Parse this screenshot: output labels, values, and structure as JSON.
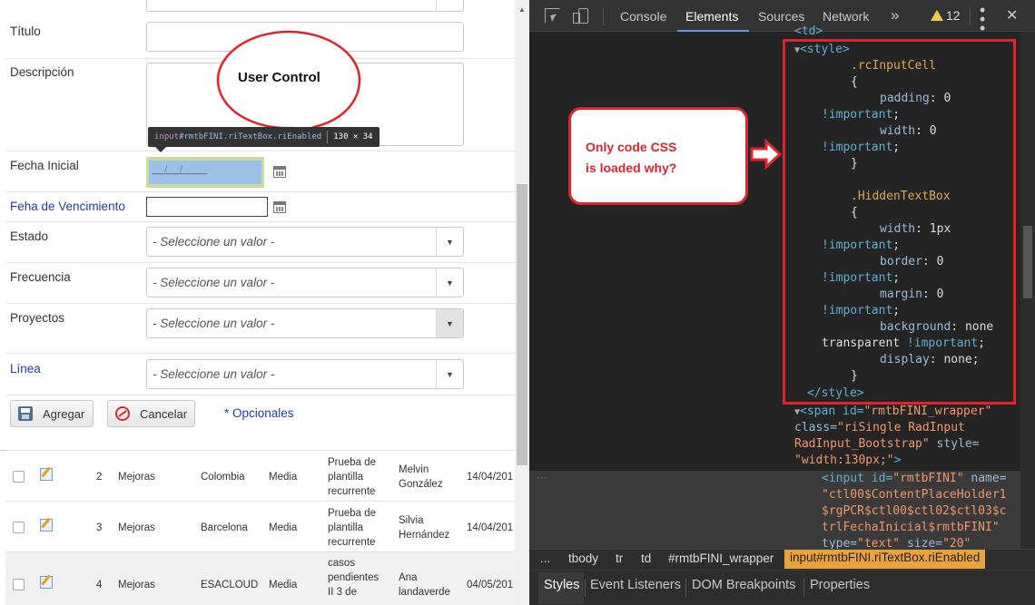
{
  "form": {
    "titulo_label": "Título",
    "descripcion_label": "Descripción",
    "fecha_inicial_label": "Fecha Inicial",
    "fecha_inicial_mask": "__/__/____",
    "fecha_vencimiento_label": "Feha de Vencimiento",
    "estado_label": "Estado",
    "frecuencia_label": "Frecuencia",
    "proyectos_label": "Proyectos",
    "linea_label": "Línea",
    "select_placeholder": "- Seleccione un valor -",
    "agregar_label": "Agregar",
    "cancelar_label": "Cancelar",
    "opcionales_label": "* Opcionales"
  },
  "callout": {
    "text": "User Control"
  },
  "inspector_tip": {
    "tag": "input",
    "selector": "#rmtbFINI.riTextBox.riEnabled",
    "size": "130 × 34"
  },
  "grid": {
    "rows": [
      {
        "num": "2",
        "tipo": "Mejoras",
        "lugar": "Colombia",
        "prioridad": "Media",
        "desc": [
          "Prueba de",
          "plantilla",
          "recurrente"
        ],
        "persona": [
          "Melvin",
          "González"
        ],
        "fecha": "14/04/201"
      },
      {
        "num": "3",
        "tipo": "Mejoras",
        "lugar": "Barcelona",
        "prioridad": "Media",
        "desc": [
          "Prueba de",
          "plantilla",
          "recurrente"
        ],
        "persona": [
          "Silvia",
          "Hernández"
        ],
        "fecha": "14/04/201"
      },
      {
        "num": "4",
        "tipo": "Mejoras",
        "lugar": "ESACLOUD",
        "prioridad": "Media",
        "desc": [
          "casos",
          "pendientes",
          "II 3 de"
        ],
        "persona": [
          "Ana",
          "landaverde"
        ],
        "fecha": "04/05/201"
      }
    ]
  },
  "devtools": {
    "tabs": [
      "Console",
      "Elements",
      "Sources",
      "Network"
    ],
    "more": "»",
    "warnings": "12",
    "crumbs": [
      "...",
      "tbody",
      "tr",
      "td",
      "#rmtbFINI_wrapper",
      "input#rmtbFINI.riTextBox.riEnabled"
    ],
    "subtabs": [
      "Styles",
      "Event Listeners",
      "DOM Breakpoints",
      "Properties"
    ],
    "code": {
      "td_partial": "<td>",
      "style_open": "<style>",
      "sel1": ".rcInputCell",
      "brace_open": "{",
      "padding_prop": "padding",
      "padding_val": "0",
      "important": "!important",
      "width_prop": "width",
      "width_val": "0",
      "brace_close": "}",
      "sel2": ".HiddenTextBox",
      "width2_val": "1px",
      "border_prop": "border",
      "border_val": "0",
      "margin_prop": "margin",
      "margin_val": "0",
      "background_prop": "background",
      "background_val": "none",
      "transparent": "transparent",
      "display_prop": "display",
      "display_val": "none",
      "style_close": "</style>",
      "span_open": "<span id=",
      "span_id": "\"rmtbFINI_wrapper\"",
      "class_attr": "class=",
      "span_class": "\"riSingle RadInput",
      "span_class2": "RadInput_Bootstrap\"",
      "style_attr": "style=",
      "span_style": "\"width:130px;\"",
      "span_end": ">",
      "input_open": "<input id=",
      "input_id": "\"rmtbFINI\"",
      "name_attr": "name=",
      "name1": "\"ctl00$ContentPlaceHolder1",
      "name2": "$rgPCR$ctl00$ctl02$ctl03$c",
      "name3": "trlFechaInicial$rmtbFINI\"",
      "type_attr": "type=",
      "type_val": "\"text\"",
      "size_attr": "size=",
      "size_val": "\"20\""
    },
    "note": [
      "Only code CSS",
      "is loaded why?"
    ]
  },
  "colors": {
    "annotation_red": "#e0242c",
    "devtools_bg": "#242424",
    "selected_crumb": "#e8a33d"
  }
}
